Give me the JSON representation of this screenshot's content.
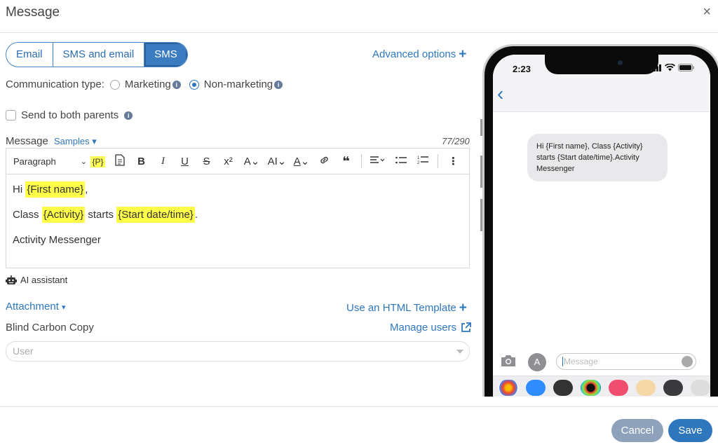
{
  "header": {
    "title": "Message",
    "close_glyph": "×"
  },
  "channel_tabs": [
    {
      "label": "Email",
      "active": false
    },
    {
      "label": "SMS and email",
      "active": false
    },
    {
      "label": "SMS",
      "active": true
    }
  ],
  "advanced_options": "Advanced options",
  "communication": {
    "label": "Communication type:",
    "options": [
      {
        "label": "Marketing",
        "selected": false
      },
      {
        "label": "Non-marketing",
        "selected": true
      }
    ]
  },
  "send_both_parents": {
    "label": "Send to both parents",
    "checked": false
  },
  "message": {
    "label": "Message",
    "samples_label": "Samples",
    "count": "77/290",
    "format_select": "Paragraph",
    "placeholder_tag": "{P}",
    "lines": [
      {
        "prefix": "Hi ",
        "tokens": [
          "{First name}"
        ],
        "suffix": ","
      },
      {
        "prefix": "Class ",
        "token1": "{Activity}",
        "mid": " starts ",
        "token2": "{Start date/time}",
        "suffix": "."
      },
      {
        "text": "Activity Messenger"
      }
    ]
  },
  "ai_assistant": "AI assistant",
  "attachment": "Attachment",
  "html_template": "Use an HTML Template",
  "bcc": {
    "label": "Blind Carbon Copy",
    "manage_users": "Manage users",
    "user_placeholder": "User"
  },
  "footer": {
    "cancel": "Cancel",
    "save": "Save"
  },
  "phone": {
    "time": "2:23",
    "bubble_text": "Hi {First name}, Class {Activity} starts {Start date/time}.Activity Messenger",
    "compose_placeholder": "Message"
  },
  "colors": {
    "accent": "#2f77bd",
    "highlight": "#ffff4a",
    "cancel_bg": "#8fa2bb"
  }
}
